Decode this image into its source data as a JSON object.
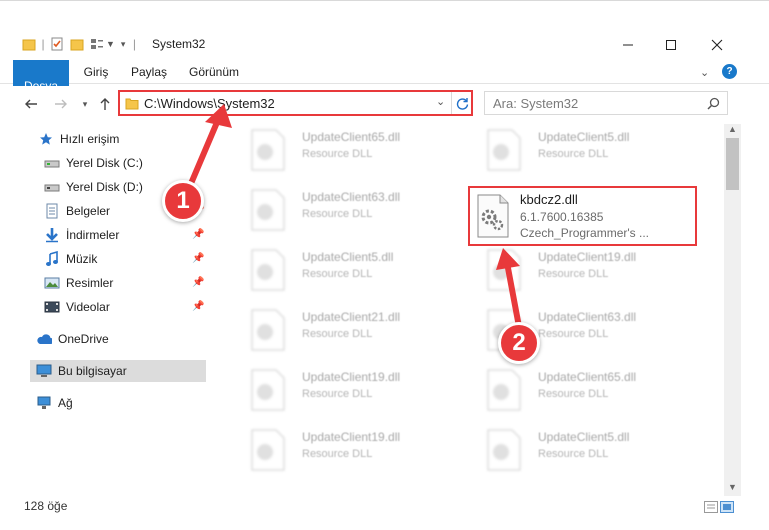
{
  "window": {
    "title": "System32"
  },
  "ribbon": {
    "tabs": [
      "Dosya",
      "Giriş",
      "Paylaş",
      "Görünüm"
    ]
  },
  "address": {
    "path": "C:\\Windows\\System32"
  },
  "search": {
    "placeholder": "Ara: System32"
  },
  "nav": {
    "items": [
      {
        "label": "Hızlı erişim",
        "icon": "star-icon",
        "pinned": false
      },
      {
        "label": "Yerel Disk (C:)",
        "icon": "drive-icon",
        "pinned": false
      },
      {
        "label": "Yerel Disk (D:)",
        "icon": "drive-icon",
        "pinned": false
      },
      {
        "label": "Belgeler",
        "icon": "documents-icon",
        "pinned": true
      },
      {
        "label": "İndirmeler",
        "icon": "download-icon",
        "pinned": true
      },
      {
        "label": "Müzik",
        "icon": "music-icon",
        "pinned": true
      },
      {
        "label": "Resimler",
        "icon": "pictures-icon",
        "pinned": true
      },
      {
        "label": "Videolar",
        "icon": "video-icon",
        "pinned": true
      },
      {
        "label": "OneDrive",
        "icon": "cloud-icon",
        "pinned": false
      },
      {
        "label": "Bu bilgisayar",
        "icon": "computer-icon",
        "pinned": false
      },
      {
        "label": "Ağ",
        "icon": "network-icon",
        "pinned": false
      }
    ]
  },
  "files": {
    "left": [
      {
        "name": "UpdateClient65.dll",
        "type": "Resource DLL"
      },
      {
        "name": "UpdateClient63.dll",
        "type": "Resource DLL"
      },
      {
        "name": "UpdateClient5.dll",
        "type": "Resource DLL"
      },
      {
        "name": "UpdateClient21.dll",
        "type": "Resource DLL"
      },
      {
        "name": "UpdateClient19.dll",
        "type": "Resource DLL"
      },
      {
        "name": "UpdateClient19.dll",
        "type": "Resource DLL"
      }
    ],
    "right": [
      {
        "name": "UpdateClient5.dll",
        "type": "Resource DLL"
      },
      {
        "name": "UpdateClient19.dll",
        "type": "Resource DLL"
      },
      {
        "name": "UpdateClient63.dll",
        "type": "Resource DLL"
      },
      {
        "name": "UpdateClient65.dll",
        "type": "Resource DLL"
      },
      {
        "name": "UpdateClient5.dll",
        "type": "Resource DLL"
      }
    ],
    "highlighted": {
      "name": "kbdcz2.dll",
      "version": "6.1.7600.16385",
      "description": "Czech_Programmer's ..."
    }
  },
  "status": {
    "count": "128 öğe"
  },
  "annotations": {
    "step1": "1",
    "step2": "2",
    "color": "#e8393b"
  }
}
